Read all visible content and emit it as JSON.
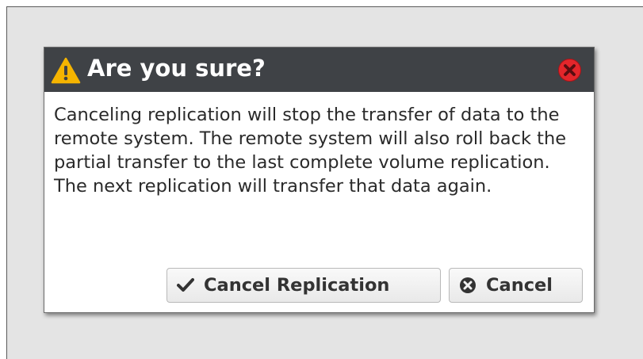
{
  "dialog": {
    "title": "Are you sure?",
    "message": "Canceling replication will stop the transfer of data to the remote system. The remote system will also roll back the partial transfer to the last complete volume replication. The next replication will transfer that data again.",
    "icons": {
      "title": "warning-icon",
      "close": "close-icon"
    },
    "colors": {
      "titlebar": "#3f4246",
      "warning": "#f5b400",
      "close": "#e3262b"
    },
    "buttons": {
      "confirm_label": "Cancel Replication",
      "confirm_icon": "checkmark-icon",
      "cancel_label": "Cancel",
      "cancel_icon": "cancel-circle-icon"
    }
  }
}
